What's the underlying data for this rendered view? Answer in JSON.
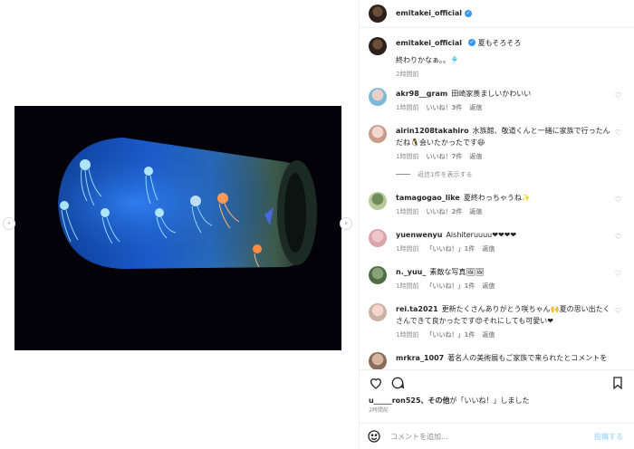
{
  "post": {
    "username": "emitakei_official",
    "caption_line1": "夏もそろそろ",
    "caption_line2": "終わりかなぁ。。🎐",
    "caption_time": "2時間前"
  },
  "comments": [
    {
      "user": "akr98__gram",
      "text": "田崎家羨ましいかわいい",
      "time": "1時間前",
      "likes": "いいね！3件",
      "reply": "返信"
    },
    {
      "user": "airin1208takahiro",
      "text": "水族館、敬道くんと一緒に家族で行ったんだね🐧会いたかったです😆",
      "time": "1時間前",
      "likes": "いいね！7件",
      "reply": "返信"
    },
    {
      "user": "tamagogao_like",
      "text": "夏終わっちゃうね✨",
      "time": "1時間前",
      "likes": "いいね！2件",
      "reply": "返信"
    },
    {
      "user": "yuenwenyu",
      "text": "Aishiteruuuu❤❤❤❤",
      "time": "1時間前",
      "likes": "「いいね！」1件",
      "reply": "返信"
    },
    {
      "user": "n._yuu_",
      "text": "素敵な写真🖼🖼",
      "time": "1時間前",
      "likes": "「いいね！」1件",
      "reply": "返信"
    },
    {
      "user": "rei.ta2021",
      "text": "更新たくさんありがとう咲ちゃん🙌夏の思い出たくさんできて良かったです😍それにしても可愛い❤",
      "time": "1時間前",
      "likes": "「いいね！」1件",
      "reply": "返信"
    },
    {
      "user": "mrkra_1007",
      "text": "著名人の美術展もご家族で来られたとコメントを",
      "time": "",
      "likes": "",
      "reply": ""
    }
  ],
  "view_replies": "返信1件を表示する",
  "likes_line_user": "u_____ron525、その他",
  "likes_line_text": "が「いいね！」しました",
  "post_time": "2時間前",
  "add_comment": {
    "placeholder": "コメントを追加...",
    "post_label": "投稿する"
  },
  "icons": {
    "heart": "heart-icon",
    "comment": "comment-icon",
    "bookmark": "bookmark-icon",
    "emoji": "emoji-icon",
    "verified": "verified-badge",
    "prev": "chevron-left-icon",
    "next": "chevron-right-icon"
  },
  "colors": {
    "verified": "#3897f0",
    "muted": "#8e8e8e",
    "post_button": "#b2dffc"
  }
}
